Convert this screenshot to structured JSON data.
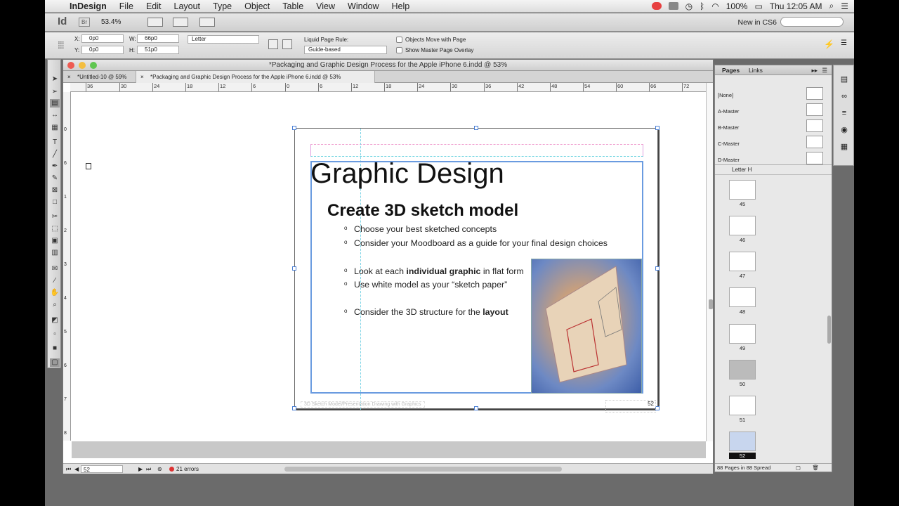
{
  "menubar": {
    "apple": "",
    "app": "InDesign",
    "items": [
      "File",
      "Edit",
      "Layout",
      "Type",
      "Object",
      "Table",
      "View",
      "Window",
      "Help"
    ],
    "battery": "100%",
    "clock": "Thu 12:05 AM"
  },
  "appbar": {
    "logo": "Id",
    "bridge": "Br",
    "zoom": "53.4%",
    "workspace": "New in CS6"
  },
  "control": {
    "x_label": "X:",
    "x_value": "0p0",
    "y_label": "Y:",
    "y_value": "0p0",
    "w_label": "W:",
    "w_value": "66p0",
    "h_label": "H:",
    "h_value": "51p0",
    "preset": "Letter",
    "liquid_label": "Liquid Page Rule:",
    "liquid_value": "Guide-based",
    "objects_move": "Objects Move with Page",
    "show_master": "Show Master Page Overlay"
  },
  "document": {
    "window_title": "*Packaging and Graphic Design Process for the Apple iPhone 6.indd @ 53%",
    "tabs": [
      "*Untitled-10 @ 59%",
      "*Packaging and Graphic Design Process for the Apple iPhone 6.indd @ 53%"
    ],
    "ruler": [
      "36",
      "30",
      "24",
      "18",
      "12",
      "6",
      "0",
      "6",
      "12",
      "18",
      "24",
      "30",
      "36",
      "42",
      "48",
      "54",
      "60",
      "66",
      "72"
    ],
    "vruler": [
      "0",
      "6",
      "1",
      "2",
      "3",
      "4",
      "5",
      "6",
      "7",
      "8"
    ],
    "page_number": "52",
    "footer_text": "3D Sketch Model/Presentation Drawing with Graphics"
  },
  "slide": {
    "title": "Graphic Design",
    "subtitle": "Create 3D sketch model",
    "bullets": [
      {
        "pre": "Choose your best sketched concepts",
        "bold": "",
        "post": ""
      },
      {
        "pre": "Consider your Moodboard as a guide for your final design choices",
        "bold": "",
        "post": ""
      },
      {
        "pre": "Look at each ",
        "bold": "individual graphic",
        "post": " in flat form"
      },
      {
        "pre": "Use white model as your “sketch paper”",
        "bold": "",
        "post": ""
      },
      {
        "pre": "Consider the 3D structure for the ",
        "bold": "layout",
        "post": ""
      }
    ]
  },
  "status": {
    "page": "52",
    "errors": "21 errors"
  },
  "pages_panel": {
    "tab_pages": "Pages",
    "tab_links": "Links",
    "masters": [
      "[None]",
      "A-Master",
      "B-Master",
      "C-Master",
      "D-Master"
    ],
    "size": "Letter H",
    "thumbs": [
      "45",
      "46",
      "47",
      "48",
      "49",
      "50",
      "51",
      "52"
    ],
    "footer": "88 Pages in 88 Spread"
  }
}
